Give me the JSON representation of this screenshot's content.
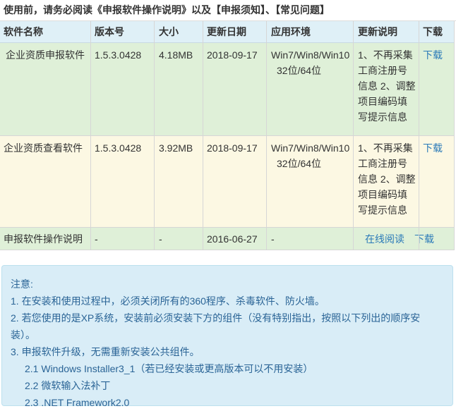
{
  "notice": "使用前，请务必阅读《申报软件操作说明》以及【申报须知】、【常见问题】",
  "table": {
    "headers": [
      "软件名称",
      "版本号",
      "大小",
      "更新日期",
      "应用环境",
      "更新说明",
      "下载"
    ],
    "rows": [
      {
        "name": "企业资质申报软件",
        "version": "1.5.3.0428",
        "size": "4.18MB",
        "date": "2018-09-17",
        "env_line1": "Win7/Win8/Win10",
        "env_line2": "32位/64位",
        "update_note": "1、不再采集工商注册号信息 2、调整项目编码填写提示信息",
        "download": "下载"
      },
      {
        "name": "企业资质查看软件",
        "version": "1.5.3.0428",
        "size": "3.92MB",
        "date": "2018-09-17",
        "env_line1": "Win7/Win8/Win10",
        "env_line2": "32位/64位",
        "update_note": "1、不再采集工商注册号信息 2、调整项目编码填写提示信息",
        "download": "下载"
      },
      {
        "name": "申报软件操作说明",
        "version": "-",
        "size": "-",
        "date": "2016-06-27",
        "env": "-",
        "read_online": "在线阅读",
        "download": "下载"
      }
    ]
  },
  "notes": {
    "title": "注意:",
    "item1": "1. 在安装和使用过程中，必须关闭所有的360程序、杀毒软件、防火墙。",
    "item2": "2. 若您使用的是XP系统，安装前必须安装下方的组件（没有特别指出，按照以下列出的顺序安装）。",
    "item3": "3. 申报软件升级，无需重新安装公共组件。",
    "sub1": "2.1 Windows Installer3_1（若已经安装或更高版本可以不用安装）",
    "sub2": "2.2 微软输入法补丁",
    "sub3": "2.3 .NET Framework2.0"
  }
}
